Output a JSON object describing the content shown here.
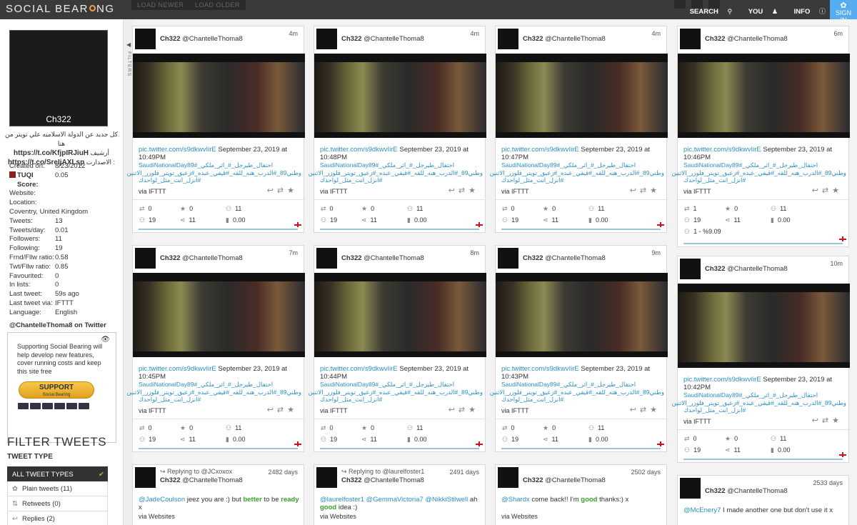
{
  "header": {
    "logo": "SOCIAL BEARING",
    "load_newer": "LOAD NEWER",
    "load_older": "LOAD OLDER",
    "nav": {
      "search": "SEARCH",
      "you": "YOU",
      "info": "INFO"
    },
    "signin_line1": "SIGN",
    "signin_line2": "IN"
  },
  "profile": {
    "avatar_name": "Ch322",
    "bio_line1": "كل جديد عن الدولة الاسلاميه علي تويتر من هنا",
    "bio_link1": "https://t.co/KfjpIRJiuH",
    "bio_word": "أرشيف",
    "bio_link2": "https://t.co/SreIjAXLsp",
    "bio_word2": ": الاصدارت",
    "stats": [
      {
        "k": "Created on:",
        "v": "8/23/2012"
      },
      {
        "k": "TUQI Score:",
        "v": "0.05"
      },
      {
        "k": "Website:",
        "v": ""
      },
      {
        "k": "Location:",
        "v": ""
      },
      {
        "k": "Coventry, United Kingdom",
        "v": ""
      },
      {
        "k": "Tweets:",
        "v": "13"
      },
      {
        "k": "Tweets/day:",
        "v": "0.01"
      },
      {
        "k": "Followers:",
        "v": "11"
      },
      {
        "k": "Following:",
        "v": "19"
      },
      {
        "k": "Frnd/Fllw ratio:",
        "v": "0.58"
      },
      {
        "k": "Twt/Fllw ratio:",
        "v": "0.85"
      },
      {
        "k": "Favourited:",
        "v": "0"
      },
      {
        "k": "In lists:",
        "v": "0"
      },
      {
        "k": "Last tweet:",
        "v": "59s ago"
      },
      {
        "k": "Last tweet via:",
        "v": "IFTTT"
      },
      {
        "k": "Language:",
        "v": "English"
      }
    ],
    "twitter_link": "@ChantelleThoma8 on Twitter"
  },
  "support": {
    "text": "Supporting Social Bearing will help develop new features, cover running costs and keep this site free",
    "button": "SUPPORT",
    "button_sub": "Social Bearing"
  },
  "filters": {
    "title": "FILTER TWEETS",
    "tweet_type": "TWEET TYPE",
    "items": [
      {
        "label": "ALL TWEET TYPES"
      },
      {
        "label": "Plain tweets (11)"
      },
      {
        "label": "Retweets (0)"
      },
      {
        "label": "Replies (2)"
      }
    ],
    "vertical_label": "FILTERS"
  },
  "cards": [
    {
      "user": "Ch322",
      "handle": "@ChantelleThoma8",
      "time": "4m",
      "link": "pic.twitter.com/s9dkwvIirE",
      "date": "September 23, 2019 at 10:49PM",
      "ar1": "احتفال_طيرجل_#_اثر_ملكي_#SaudiNationalDay89",
      "ar2": "وطني89_#الدرب_هنه_للقه_#قيفي_عبده_#زعيق_تويتر_فلوزر_الاثنين",
      "ar3": "#انزل_انت_مثل_لواحدك",
      "via": "via IFTTT",
      "rt": "0",
      "fav": "0",
      "c3": "11",
      "c4": "19",
      "c5": "11",
      "c6": "0.00",
      "extra": ""
    },
    {
      "user": "Ch322",
      "handle": "@ChantelleThoma8",
      "time": "4m",
      "link": "pic.twitter.com/s9dkwvIirE",
      "date": "September 23, 2019 at 10:48PM",
      "ar1": "احتفال_طيرجل_#_اثر_ملكي_#SaudiNationalDay89",
      "ar2": "وطني89_#الدرب_هنه_للقه_#قيفي_عبده_#زعيق_تويتر_فلوزر_الاثنين",
      "ar3": "#انزل_انت_مثل_لواحدك",
      "via": "via IFTTT",
      "rt": "0",
      "fav": "0",
      "c3": "11",
      "c4": "19",
      "c5": "11",
      "c6": "0.00",
      "extra": ""
    },
    {
      "user": "Ch322",
      "handle": "@ChantelleThoma8",
      "time": "4m",
      "link": "pic.twitter.com/s9dkwvIirE",
      "date": "September 23, 2019 at 10:47PM",
      "ar1": "احتفال_طيرجل_#_اثر_ملكي_#SaudiNationalDay89",
      "ar2": "وطني89_#الدرب_هنه_للقه_#قيفي_عبده_#زعيق_تويتر_فلوزر_الاثنين",
      "ar3": "#انزل_انت_مثل_لواحدك",
      "via": "via IFTTT",
      "rt": "0",
      "fav": "0",
      "c3": "11",
      "c4": "19",
      "c5": "11",
      "c6": "0.00",
      "extra": ""
    },
    {
      "user": "Ch322",
      "handle": "@ChantelleThoma8",
      "time": "6m",
      "link": "pic.twitter.com/s9dkwvIirE",
      "date": "September 23, 2019 at 10:46PM",
      "ar1": "احتفال_طيرجل_#_اثر_ملكي_#SaudiNationalDay89",
      "ar2": "وطني89_#الدرب_هنه_للقه_#قيفي_عبده_#زعيق_تويتر_فلوزر_الاثنين",
      "ar3": "#انزل_انت_مثل_لواحدك",
      "via": "via IFTTT",
      "rt": "1",
      "fav": "0",
      "c3": "11",
      "c4": "19",
      "c5": "11",
      "c6": "0.00",
      "extra": "1 - %9.09"
    },
    {
      "user": "Ch322",
      "handle": "@ChantelleThoma8",
      "time": "7m",
      "link": "pic.twitter.com/s9dkwvIirE",
      "date": "September 23, 2019 at 10:45PM",
      "ar1": "احتفال_طيرجل_#_اثر_ملكي_#SaudiNationalDay89",
      "ar2": "وطني89_#الدرب_هنه_للقه_#قيفي_عبده_#زعيق_تويتر_فلوزر_الاثنين",
      "ar3": "#انزل_انت_مثل_لواحدك",
      "via": "via IFTTT",
      "rt": "0",
      "fav": "0",
      "c3": "11",
      "c4": "19",
      "c5": "11",
      "c6": "0.00",
      "extra": ""
    },
    {
      "user": "Ch322",
      "handle": "@ChantelleThoma8",
      "time": "8m",
      "link": "pic.twitter.com/s9dkwvIirE",
      "date": "September 23, 2019 at 10:44PM",
      "ar1": "احتفال_طيرجل_#_اثر_ملكي_#SaudiNationalDay89",
      "ar2": "وطني89_#الدرب_هنه_للقه_#قيفي_عبده_#زعيق_تويتر_فلوزر_الاثنين",
      "ar3": "#انزل_انت_مثل_لواحدك",
      "via": "via IFTTT",
      "rt": "0",
      "fav": "0",
      "c3": "11",
      "c4": "19",
      "c5": "11",
      "c6": "0.00",
      "extra": ""
    },
    {
      "user": "Ch322",
      "handle": "@ChantelleThoma8",
      "time": "9m",
      "link": "pic.twitter.com/s9dkwvIirE",
      "date": "September 23, 2019 at 10:43PM",
      "ar1": "احتفال_طيرجل_#_اثر_ملكي_#SaudiNationalDay89",
      "ar2": "وطني89_#الدرب_هنه_للقه_#قيفي_عبده_#زعيق_تويتر_فلوزر_الاثنين",
      "ar3": "#انزل_انت_مثل_لواحدك",
      "via": "via IFTTT",
      "rt": "0",
      "fav": "0",
      "c3": "11",
      "c4": "19",
      "c5": "11",
      "c6": "0.00",
      "extra": ""
    },
    {
      "user": "Ch322",
      "handle": "@ChantelleThoma8",
      "time": "10m",
      "link": "pic.twitter.com/s9dkwvIirE",
      "date": "September 23, 2019 at 10:42PM",
      "ar1": "احتفال_طيرجل_#_اثر_ملكي_#SaudiNationalDay89",
      "ar2": "وطني89_#الدرب_هنه_للقه_#قيفي_عبده_#زعيق_تويتر_فلوزر_الاثنين",
      "ar3": "#انزل_انت_مثل_لواحدك",
      "via": "via IFTTT",
      "rt": "0",
      "fav": "0",
      "c3": "11",
      "c4": "19",
      "c5": "11",
      "c6": "0.00",
      "extra": ""
    }
  ],
  "replies": [
    {
      "reply_to": "Replying to @JCxoxox",
      "user": "Ch322",
      "handle": "@ChantelleThoma8",
      "time": "2482 days",
      "mention": "@JadeCoulson",
      "text1": " jeez you are :) but ",
      "green1": "better",
      "text2": " to be ",
      "green2": "ready",
      "text3": " x",
      "via": "via Websites"
    },
    {
      "reply_to": "Replying to @laurelfoster1",
      "user": "Ch322",
      "handle": "@ChantelleThoma8",
      "time": "2491 days",
      "mention": "@laurelfoster1 @GemmaVictoria7 @NikkiStilwell",
      "text1": " ah ",
      "green1": "good",
      "text2": " idea :)",
      "green2": "",
      "text3": "",
      "via": "via Websites"
    },
    {
      "reply_to": "",
      "user": "Ch322",
      "handle": "@ChantelleThoma8",
      "time": "2502 days",
      "mention": "@Shardx",
      "text1": " come back!! I'm ",
      "green1": "good",
      "text2": " thanks:) x",
      "green2": "",
      "text3": "",
      "via": "via Websites"
    },
    {
      "reply_to": "",
      "user": "Ch322",
      "handle": "@ChantelleThoma8",
      "time": "2533 days",
      "mention": "@McEnery7",
      "text1": " I made another one but don't use it x",
      "green1": "",
      "text2": "",
      "green2": "",
      "text3": "",
      "via": ""
    }
  ]
}
